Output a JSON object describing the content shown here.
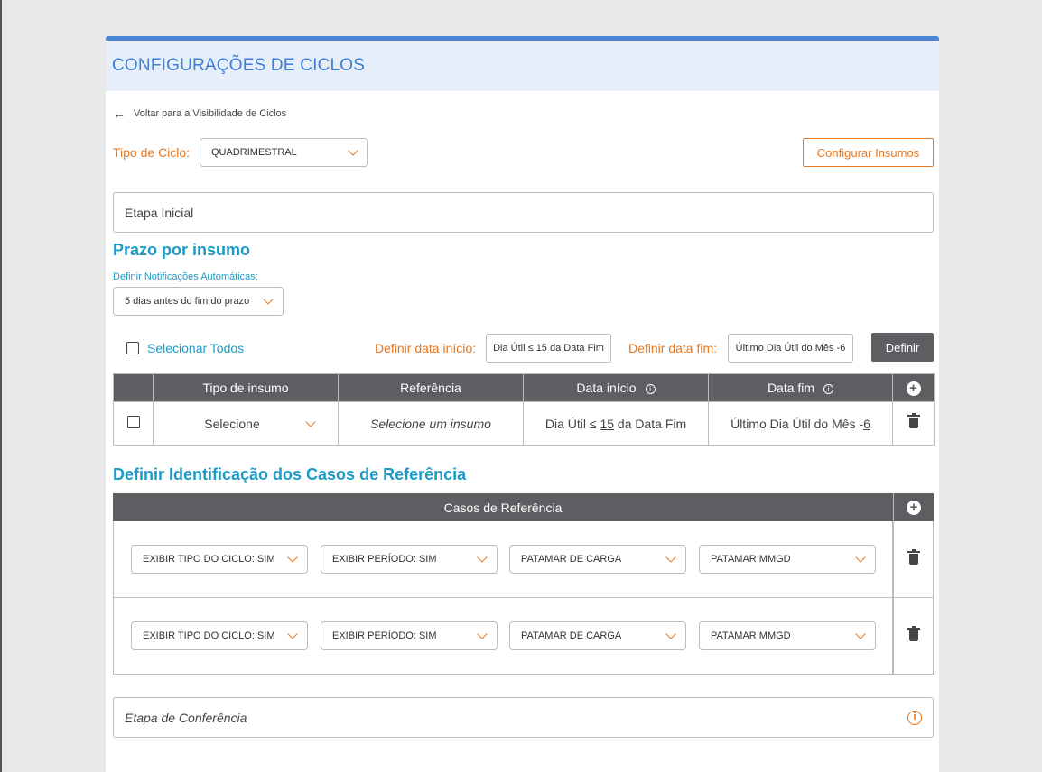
{
  "header": {
    "title": "CONFIGURAÇÕES DE CICLOS"
  },
  "back_link": {
    "label": "Voltar para a Visibilidade de Ciclos"
  },
  "cycle": {
    "label": "Tipo de Ciclo:",
    "value": "QUADRIMESTRAL"
  },
  "configure_button": "Configurar Insumos",
  "initial_stage": "Etapa Inicial",
  "deadline_section": {
    "title": "Prazo por insumo",
    "notif_label": "Definir Notificações Automáticas:",
    "notif_value": "5 dias antes do fim do prazo",
    "select_all": "Selecionar Todos",
    "start_label": "Definir data início:",
    "start_value": "Dia Útil ≤ 15 da Data Fim",
    "end_label": "Definir data fim:",
    "end_value": "Último Dia Útil do Mês -6",
    "define_button": "Definir"
  },
  "table": {
    "headers": {
      "tipo": "Tipo de insumo",
      "ref": "Referência",
      "inicio": "Data início",
      "fim": "Data fim"
    },
    "row": {
      "tipo": "Selecione",
      "ref": "Selecione um insumo",
      "inicio_prefix": "Dia Útil ≤",
      "inicio_num": "15",
      "inicio_suffix": "da Data Fim",
      "fim_prefix": "Último Dia Útil do Mês -",
      "fim_num": "6"
    }
  },
  "reference_section": {
    "title": "Definir Identificação dos Casos de Referência",
    "header": "Casos de Referência",
    "rows": [
      {
        "a": "EXIBIR TIPO DO CICLO: SIM",
        "b": "EXIBIR PERÍODO: SIM",
        "c": "PATAMAR DE CARGA",
        "d": "PATAMAR MMGD"
      },
      {
        "a": "EXIBIR TIPO DO CICLO: SIM",
        "b": "EXIBIR PERÍODO: SIM",
        "c": "PATAMAR DE CARGA",
        "d": "PATAMAR MMGD"
      }
    ]
  },
  "conference_stage": "Etapa de Conferência",
  "icons": {
    "info": "ⓘ",
    "plus": "+",
    "back": "←",
    "warn": "i"
  },
  "colors": {
    "accent_blue": "#3f7ed4",
    "section_blue": "#1d9bc6",
    "orange": "#e8761d",
    "dark": "#5e5d62"
  }
}
